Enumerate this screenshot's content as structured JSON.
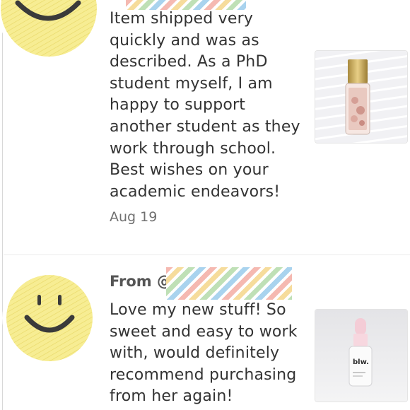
{
  "reviews": [
    {
      "text": "Item shipped very quickly and was as described. As a PhD student myself, I am happy to support another student as they work through school. Best wishes on your academic endeavors!",
      "date": "Aug 19",
      "avatar_icon": "smiley-face-icon",
      "photo_icon": "perfume-bottle-icon"
    },
    {
      "from_label": "From @",
      "text": "Love my new stuff! So sweet and easy to work with, would definitely recommend purchasing from her again!",
      "avatar_icon": "smiley-face-icon",
      "photo_icon": "serum-dropper-bottle-icon",
      "photo_brand_text": "blw."
    }
  ],
  "colors": {
    "avatar_yellow": "#f6e98a",
    "text": "#333333",
    "date": "#707070",
    "divider": "#ececec"
  }
}
